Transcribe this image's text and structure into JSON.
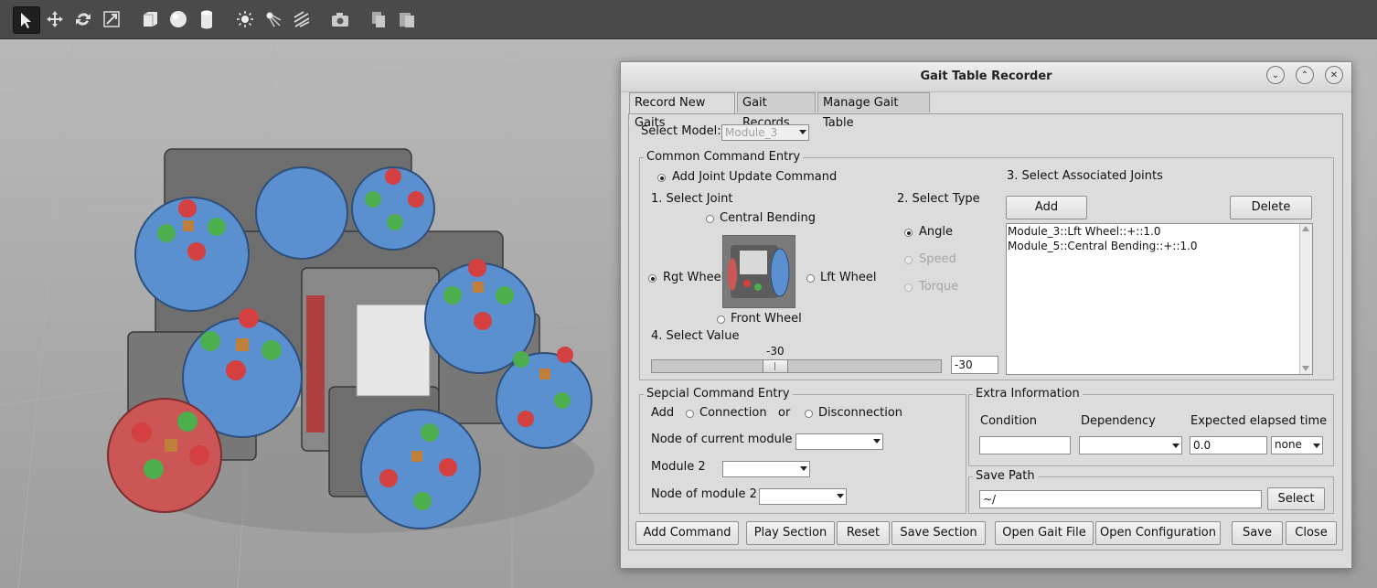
{
  "dialog": {
    "title": "Gait Table Recorder",
    "tabs": [
      "Record New Gaits",
      "Gait Records",
      "Manage Gait Table"
    ],
    "active_tab": "Record New Gaits"
  },
  "record": {
    "select_model_label": "Select Model:",
    "select_model_value": "Module_3",
    "common": {
      "title": "Common Command Entry",
      "add_joint_update": "Add Joint Update Command",
      "select_joint_label": "1. Select Joint",
      "joints": {
        "central": "Central Bending",
        "rgt": "Rgt Wheel",
        "lft": "Lft Wheel",
        "front": "Front Wheel"
      },
      "selected_joint": "Rgt Wheel",
      "select_type_label": "2. Select Type",
      "types": [
        "Angle",
        "Speed",
        "Torque"
      ],
      "selected_type": "Angle",
      "select_value_label": "4. Select Value",
      "slider_value": "-30",
      "value_field": "-30",
      "assoc_label": "3. Select Associated Joints",
      "add_button": "Add",
      "delete_button": "Delete",
      "joint_list": [
        "Module_3::Lft Wheel::+::1.0",
        "Module_5::Central Bending::+::1.0"
      ]
    },
    "special": {
      "title": "Sepcial Command Entry",
      "add_label": "Add",
      "connection": "Connection",
      "or_label": "or",
      "disconnection": "Disconnection",
      "node_current": "Node of current module",
      "module2": "Module 2",
      "node_module2": "Node of module 2"
    },
    "extra": {
      "title": "Extra Information",
      "condition": "Condition",
      "dependency": "Dependency",
      "elapsed": "Expected elapsed time",
      "elapsed_value": "0.0",
      "unit_value": "none"
    },
    "save_path": {
      "title": "Save Path",
      "value": "~/",
      "select_button": "Select"
    }
  },
  "bottom_buttons": {
    "add_command": "Add Command",
    "play_section": "Play Section",
    "reset": "Reset",
    "save_section": "Save Section",
    "open_gait_file": "Open Gait File",
    "open_configuration": "Open Configuration",
    "save": "Save",
    "close": "Close"
  },
  "toolbar_icons": [
    "select-arrow-icon",
    "translate-icon",
    "rotate-icon",
    "scale-icon",
    "box-icon",
    "sphere-icon",
    "cylinder-icon",
    "point-light-icon",
    "spot-light-icon",
    "directional-light-icon",
    "camera-icon",
    "copy-icon",
    "paste-icon"
  ],
  "colors": {
    "dialog_bg": "#dcdcdc",
    "toolbar_bg": "#4a4a4a",
    "wheel_blue": "#5a8fd0",
    "wheel_red": "#cc5555",
    "wheel_green": "#4cae4c"
  }
}
